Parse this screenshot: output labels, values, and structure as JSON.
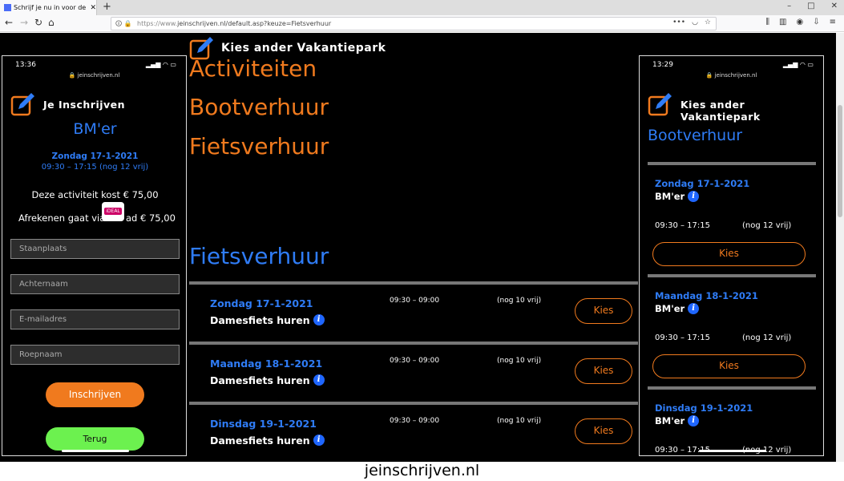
{
  "browser": {
    "tab_title": "Schrijf je nu in voor de leukste",
    "tab_close": "✕",
    "new_tab": "+",
    "url_prefix": "https://www.",
    "url": "jeinschrijven.nl/default.asp?keuze=Fietsverhuur",
    "window_minimize": "–",
    "window_maximize": "□",
    "window_close": "✕",
    "back": "←",
    "forward": "→",
    "reload": "↻",
    "home": "⌂",
    "more": "•••"
  },
  "center": {
    "header_title": "Kies ander Vakantiepark",
    "categories": [
      "Activiteiten",
      "Bootverhuur",
      "Fietsverhuur"
    ],
    "section_title": "Fietsverhuur",
    "rows": [
      {
        "date": "Zondag  17-1-2021",
        "name": "Damesfiets huren",
        "time": "09:30 – 09:00",
        "free": "(nog 10 vrij)",
        "button": "Kies"
      },
      {
        "date": "Maandag  18-1-2021",
        "name": "Damesfiets huren",
        "time": "09:30 – 09:00",
        "free": "(nog 10 vrij)",
        "button": "Kies"
      },
      {
        "date": "Dinsdag  19-1-2021",
        "name": "Damesfiets huren",
        "time": "09:30 – 09:00",
        "free": "(nog 10 vrij)",
        "button": "Kies"
      }
    ]
  },
  "left_phone": {
    "time": "13:36",
    "url": "jeinschrijven.nl",
    "title": "Je Inschrijven",
    "activity": "BM'er",
    "date": "Zondag  17-1-2021",
    "time_range": "09:30 – 17:15   (nog 12 vrij)",
    "cost": "Deze activiteit kost € 75,00",
    "pay_prefix": "Afrekenen gaat via",
    "pay_logo": "iDEAL",
    "pay_suffix": "ad € 75,00",
    "fields": [
      "Staanplaats",
      "Achternaam",
      "E-mailadres",
      "Roepnaam"
    ],
    "submit": "Inschrijven",
    "back": "Terug"
  },
  "right_phone": {
    "time": "13:29",
    "url": "jeinschrijven.nl",
    "title": "Kies ander Vakantiepark",
    "section": "Bootverhuur",
    "rows": [
      {
        "date": "Zondag  17-1-2021",
        "name": "BM'er",
        "time": "09:30 – 17:15",
        "free": "(nog 12 vrij)",
        "button": "Kies"
      },
      {
        "date": "Maandag  18-1-2021",
        "name": "BM'er",
        "time": "09:30 – 17:15",
        "free": "(nog 12 vrij)",
        "button": "Kies"
      },
      {
        "date": "Dinsdag  19-1-2021",
        "name": "BM'er",
        "time": "09:30 – 17:15",
        "free": "(nog 12 vrij)",
        "button": ""
      }
    ]
  },
  "caption": "jeinschrijven.nl",
  "colors": {
    "orange": "#f07a1e",
    "blue": "#2f7cf6",
    "green": "#6cf14f",
    "info_blue": "#1f66ff"
  }
}
